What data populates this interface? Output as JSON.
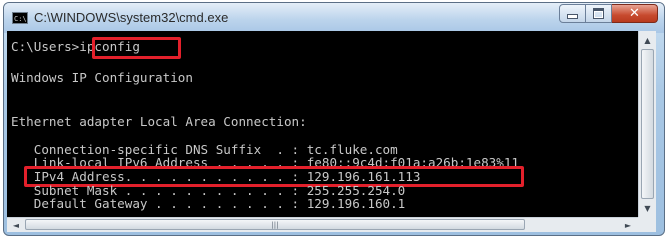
{
  "window": {
    "title": "C:\\WINDOWS\\system32\\cmd.exe",
    "icon": "cmd-icon",
    "icon_text": "C:\\",
    "buttons": {
      "minimize": "minimize-icon",
      "maximize": "maximize-icon",
      "close": "close-icon",
      "close_glyph": "✕"
    }
  },
  "console": {
    "prompt": "C:\\Users",
    "command": ">ipconfig",
    "lines": [
      "Windows IP Configuration",
      "Ethernet adapter Local Area Connection:",
      "   Connection-specific DNS Suffix  . : tc.fluke.com",
      "   Link-local IPv6 Address . . . . . : fe80::9c4d:f01a:a26b:1e83%11",
      "   IPv4 Address. . . . . . . . . . . : 129.196.161.113",
      "   Subnet Mask . . . . . . . . . . . : 255.255.254.0",
      "   Default Gateway . . . . . . . . . : 129.196.160.1"
    ]
  },
  "scrollbars": {
    "up_arrow": "▲",
    "down_arrow": "▼",
    "left_arrow": "◄",
    "right_arrow": "►",
    "thumb_grip": "|||"
  },
  "colors": {
    "console_bg": "#000000",
    "console_text": "#c8c8c8",
    "highlight_box": "#e3202b"
  }
}
